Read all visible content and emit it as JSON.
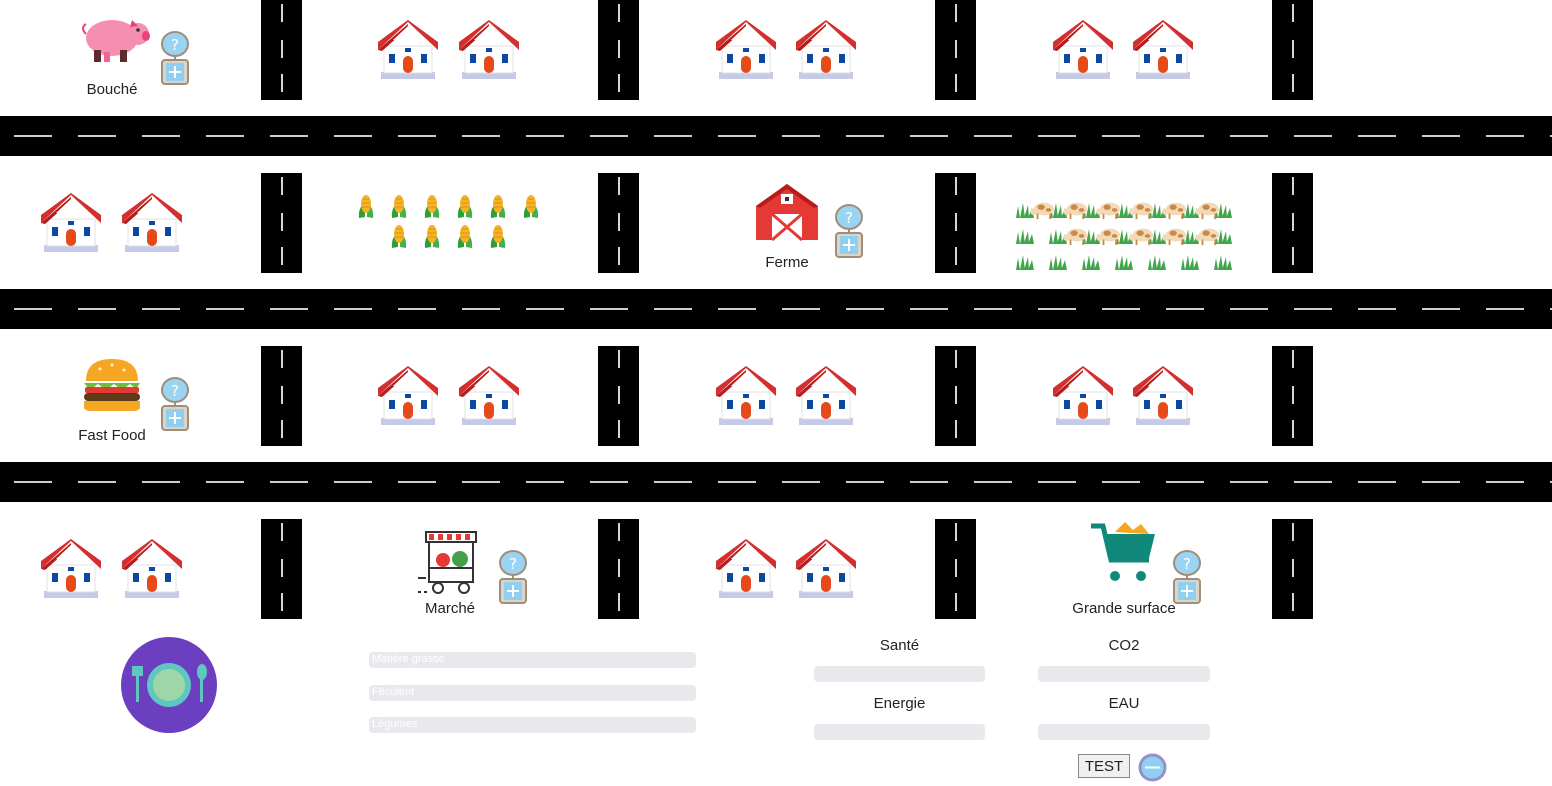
{
  "places": {
    "bouche": "Bouché",
    "ferme": "Ferme",
    "fastfood": "Fast Food",
    "marche": "Marché",
    "grande_surface": "Grande surface"
  },
  "diet_bars": [
    "Matière grasse",
    "Féculent",
    "Légumes"
  ],
  "stats": {
    "sante": "Santé",
    "co2": "CO2",
    "energie": "Energie",
    "eau": "EAU"
  },
  "buttons": {
    "test": "TEST"
  },
  "icons": {
    "pig": "pig-icon",
    "barn": "barn-icon",
    "burger": "burger-icon",
    "market": "market-stall-icon",
    "cart": "shopping-cart-icon",
    "plate": "plate-icon",
    "house": "house-icon",
    "corn": "corn-icon",
    "cow": "cow-icon",
    "help": "help-plus-icon",
    "minus": "minus-icon"
  },
  "colors": {
    "road": "#000000",
    "house_roof": "#d32f2f",
    "plate_bg": "#6b3fbf",
    "cart": "#10897b"
  }
}
